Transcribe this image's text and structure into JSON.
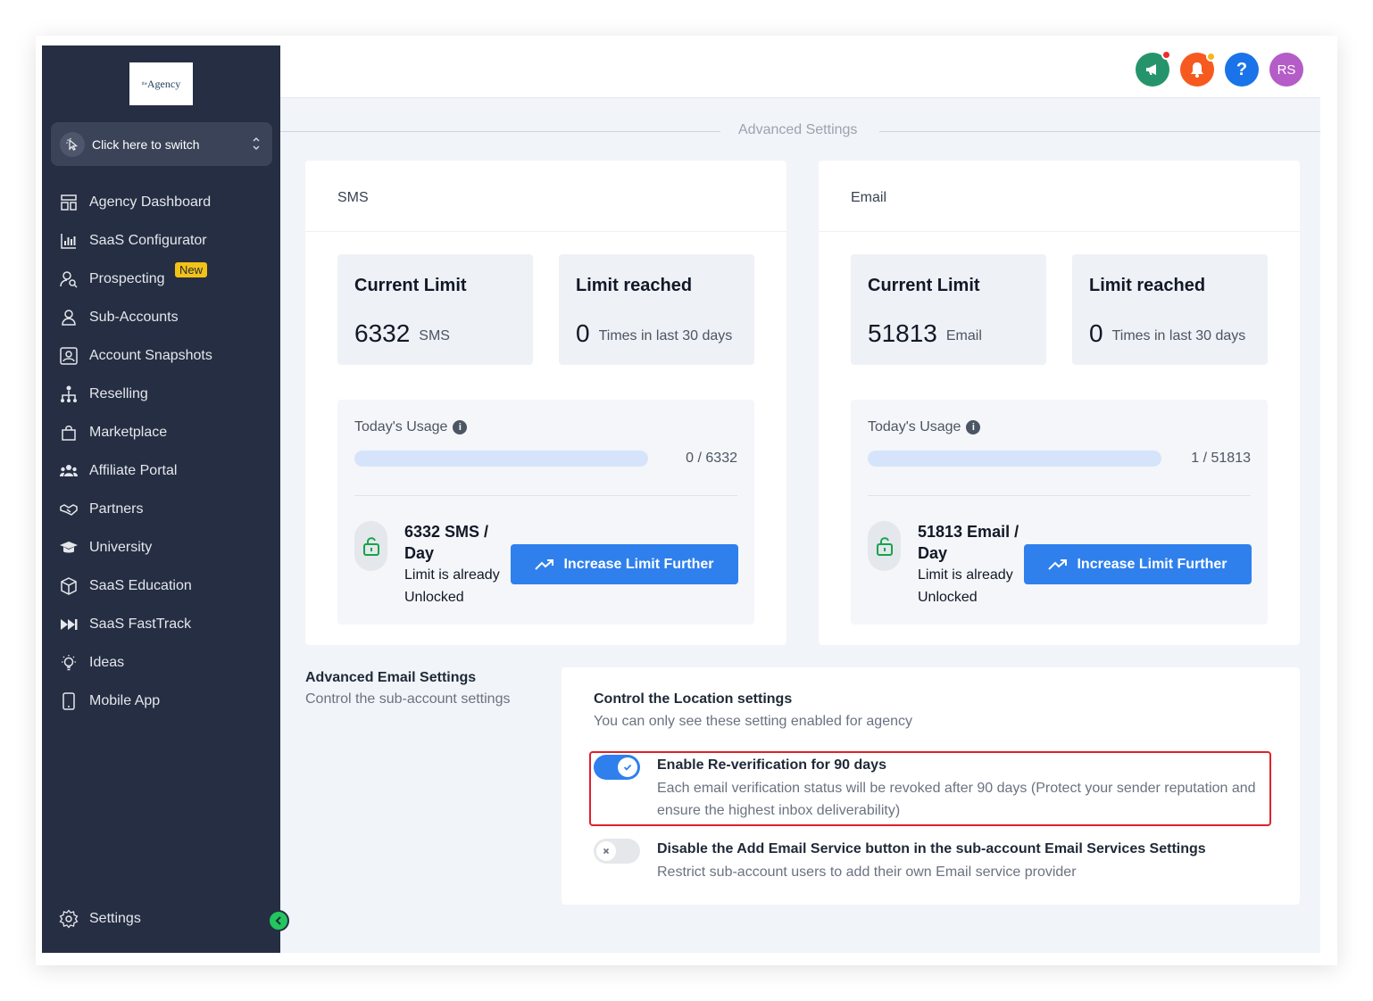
{
  "logo": {
    "sup": "the",
    "text": "Agency"
  },
  "switcher": {
    "label": "Click here to switch"
  },
  "sidebar": {
    "items": [
      {
        "label": "Agency Dashboard"
      },
      {
        "label": "SaaS Configurator"
      },
      {
        "label": "Prospecting",
        "badge": "New"
      },
      {
        "label": "Sub-Accounts"
      },
      {
        "label": "Account Snapshots"
      },
      {
        "label": "Reselling"
      },
      {
        "label": "Marketplace"
      },
      {
        "label": "Affiliate Portal"
      },
      {
        "label": "Partners"
      },
      {
        "label": "University"
      },
      {
        "label": "SaaS Education"
      },
      {
        "label": "SaaS FastTrack"
      },
      {
        "label": "Ideas"
      },
      {
        "label": "Mobile App"
      }
    ],
    "settings": "Settings"
  },
  "header": {
    "avatar": "RS",
    "help": "?"
  },
  "section_title": "Advanced Settings",
  "sms": {
    "title": "SMS",
    "current_limit_label": "Current Limit",
    "current_limit_value": "6332",
    "current_limit_unit": "SMS",
    "limit_reached_label": "Limit reached",
    "limit_reached_value": "0",
    "limit_reached_unit": "Times in last 30 days",
    "usage_label": "Today's Usage",
    "usage_count": "0 / 6332",
    "usage_fraction": 0,
    "per_day": "6332 SMS / Day",
    "unlocked": "Limit is already Unlocked",
    "button": "Increase Limit Further"
  },
  "email": {
    "title": "Email",
    "current_limit_label": "Current Limit",
    "current_limit_value": "51813",
    "current_limit_unit": "Email",
    "limit_reached_label": "Limit reached",
    "limit_reached_value": "0",
    "limit_reached_unit": "Times in last 30 days",
    "usage_label": "Today's Usage",
    "usage_count": "1 / 51813",
    "usage_fraction": 2e-05,
    "per_day": "51813 Email / Day",
    "unlocked": "Limit is already Unlocked",
    "button": "Increase Limit Further"
  },
  "advanced_email": {
    "title": "Advanced Email Settings",
    "subtitle": "Control the sub-account settings",
    "card_title": "Control the Location settings",
    "card_subtitle": "You can only see these setting enabled for agency",
    "options": [
      {
        "title": "Enable Re-verification for 90 days",
        "desc": "Each email verification status will be revoked after 90 days (Protect your sender reputation and ensure the highest inbox deliverability)",
        "enabled": true
      },
      {
        "title": "Disable the Add Email Service button in the sub-account Email Services Settings",
        "desc": "Restrict sub-account users to add their own Email service provider",
        "enabled": false
      }
    ]
  },
  "colors": {
    "sidebar": "#252e43",
    "primary": "#2f80ed",
    "toggle_on": "#2f80ed",
    "highlight": "#e0202b",
    "unlock_green": "#16a34a"
  }
}
